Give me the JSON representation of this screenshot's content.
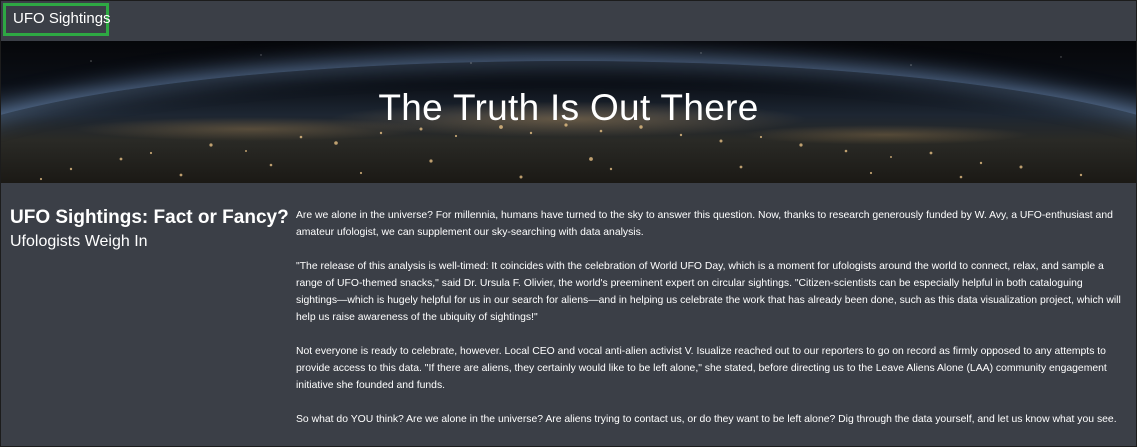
{
  "navbar": {
    "brand": "UFO Sightings"
  },
  "hero": {
    "title": "The Truth Is Out There"
  },
  "sidebar": {
    "heading": "UFO Sightings: Fact or Fancy?",
    "subheading": "Ufologists Weigh In"
  },
  "article": {
    "paragraphs": [
      "Are we alone in the universe? For millennia, humans have turned to the sky to answer this question. Now, thanks to research generously funded by W. Avy, a UFO-enthusiast and amateur ufologist, we can supplement our sky-searching with data analysis.",
      "\"The release of this analysis is well-timed: It coincides with the celebration of World UFO Day, which is a moment for ufologists around the world to connect, relax, and sample a range of UFO-themed snacks,\" said Dr. Ursula F. Olivier, the world's preeminent expert on circular sightings. \"Citizen-scientists can be especially helpful in both cataloguing sightings—which is hugely helpful for us in our search for aliens—and in helping us celebrate the work that has already been done, such as this data visualization project, which will help us raise awareness of the ubiquity of sightings!\"",
      "Not everyone is ready to celebrate, however. Local CEO and vocal anti-alien activist V. Isualize reached out to our reporters to go on record as firmly opposed to any attempts to provide access to this data. \"If there are aliens, they certainly would like to be left alone,\" she stated, before directing us to the Leave Aliens Alone (LAA) community engagement initiative she founded and funds.",
      "So what do YOU think? Are we alone in the universe? Are aliens trying to contact us, or do they want to be left alone? Dig through the data yourself, and let us know what you see."
    ]
  }
}
